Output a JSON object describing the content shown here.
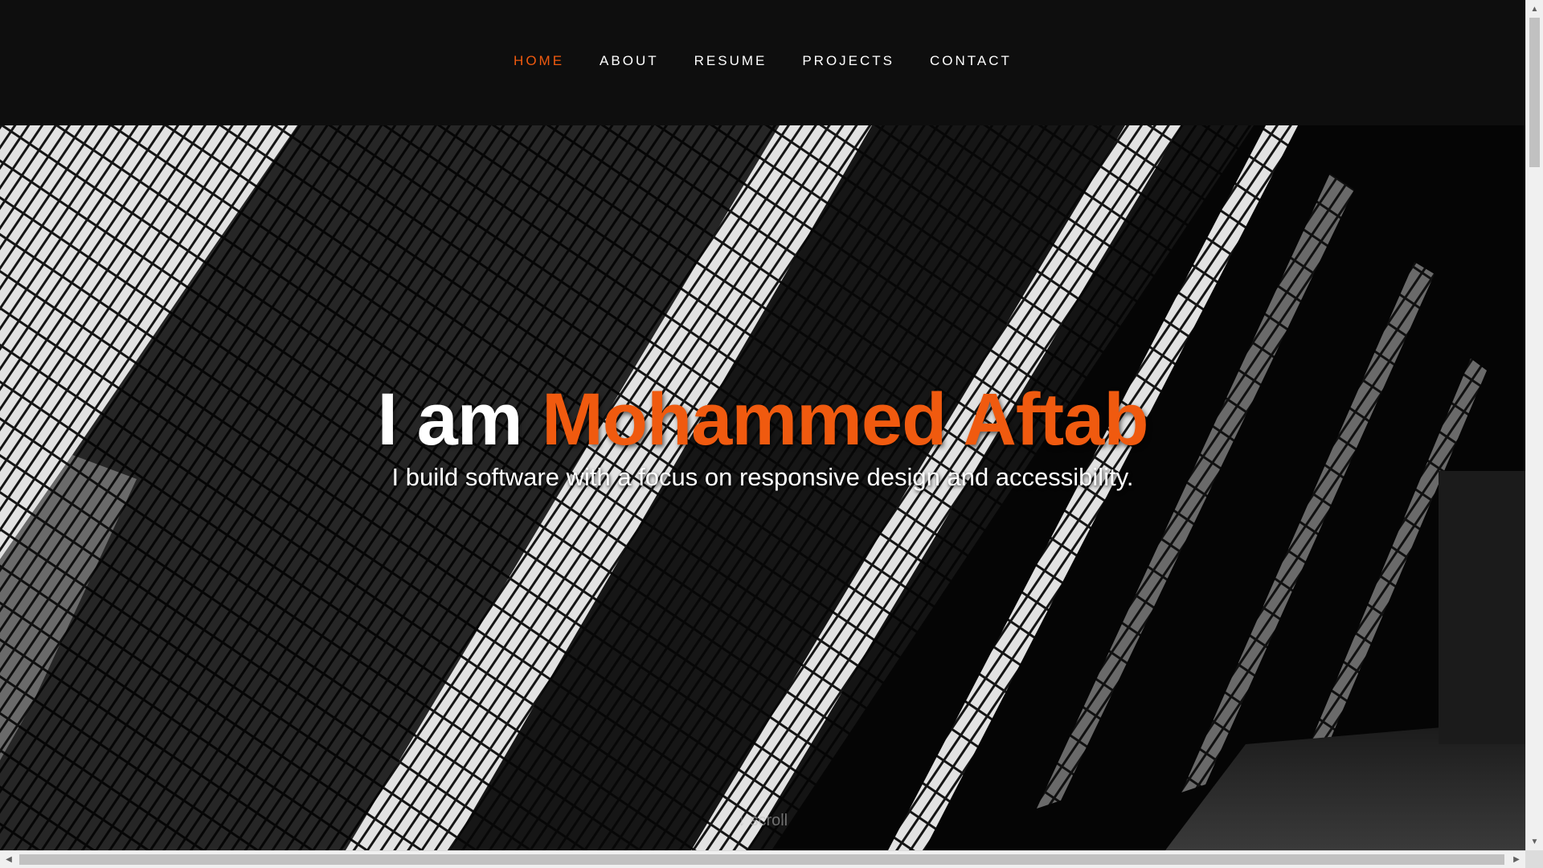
{
  "nav": {
    "items": [
      {
        "label": "HOME",
        "active": true
      },
      {
        "label": "ABOUT",
        "active": false
      },
      {
        "label": "RESUME",
        "active": false
      },
      {
        "label": "PROJECTS",
        "active": false
      },
      {
        "label": "CONTACT",
        "active": false
      }
    ]
  },
  "hero": {
    "greeting": "I am",
    "name": "Mohammed Aftab",
    "tagline": "I build software with a focus on responsive design and accessibility.",
    "scroll_label": "scroll",
    "scroll_icon": "arrow-down-icon"
  },
  "colors": {
    "accent": "#f05a0f",
    "nav_background": "#0e0e0e",
    "text": "#ffffff"
  }
}
